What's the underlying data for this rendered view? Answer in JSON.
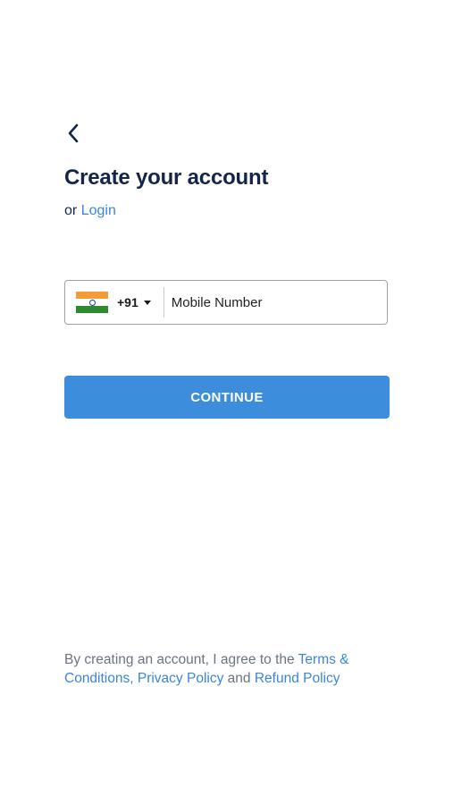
{
  "header": {
    "back_icon": "chevron-left-icon",
    "title": "Create your account",
    "login_prefix": "or",
    "login_link": "Login"
  },
  "phone": {
    "country_flag": "india-flag-icon",
    "dial_code": "+91",
    "placeholder": "Mobile Number",
    "value": ""
  },
  "actions": {
    "continue_label": "CONTINUE"
  },
  "footer": {
    "prefix": "By creating an account, I agree to the",
    "terms_link": "Terms & Conditions,",
    "privacy_link": "Privacy Policy",
    "and_text": "and",
    "refund_link": "Refund Policy"
  },
  "colors": {
    "primary": "#3d8ddd",
    "link": "#3b86d8",
    "heading": "#15254a",
    "muted_text": "#6b7380",
    "field_border": "#9aa2ad"
  }
}
